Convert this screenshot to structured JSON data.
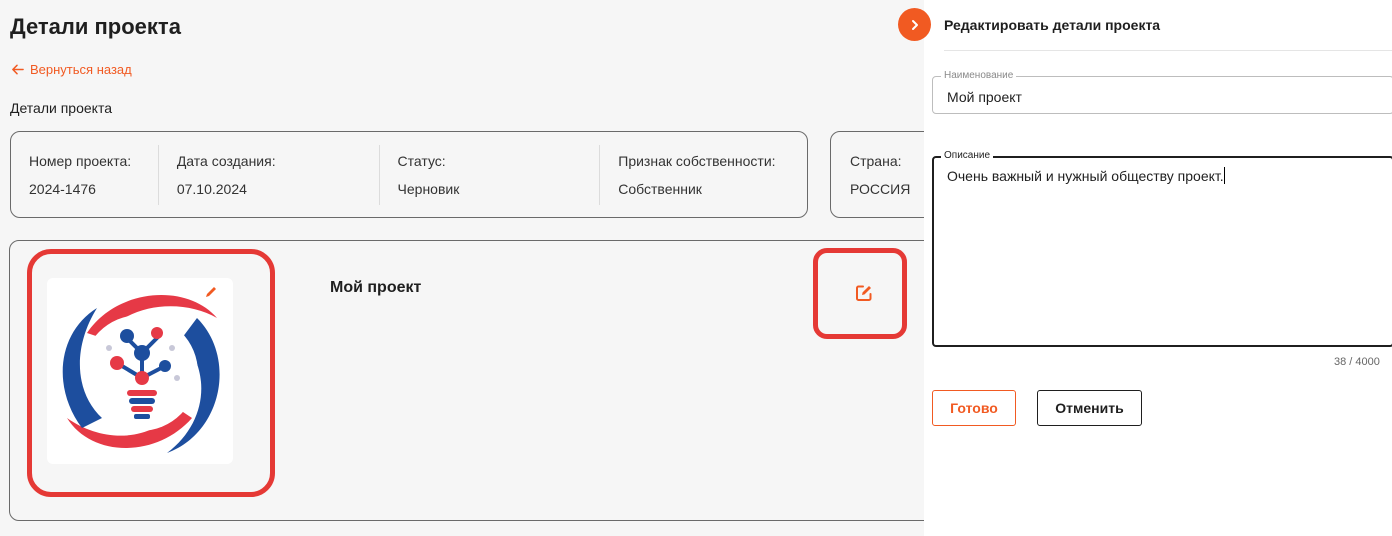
{
  "page": {
    "title": "Детали проекта",
    "back_label": "Вернуться назад",
    "section_label": "Детали проекта"
  },
  "info": {
    "items": [
      {
        "label": "Номер проекта:",
        "value": "2024-1476"
      },
      {
        "label": "Дата создания:",
        "value": "07.10.2024"
      },
      {
        "label": "Статус:",
        "value": "Черновик"
      },
      {
        "label": "Признак собственности:",
        "value": "Собственник"
      },
      {
        "label": "Страна:",
        "value": "РОССИЯ"
      }
    ]
  },
  "project": {
    "name": "Мой проект"
  },
  "drawer": {
    "title": "Редактировать детали проекта",
    "name_field": {
      "legend": "Наименование",
      "value": "Мой проект"
    },
    "desc_field": {
      "legend": "Описание",
      "value": "Очень важный и нужный обществу проект."
    },
    "counter": "38 / 4000",
    "done_label": "Готово",
    "cancel_label": "Отменить"
  },
  "colors": {
    "accent": "#f15a22",
    "highlight": "#e53935"
  },
  "icons": [
    "arrow-left-icon",
    "chevron-right-icon",
    "pencil-icon",
    "edit-square-icon"
  ]
}
